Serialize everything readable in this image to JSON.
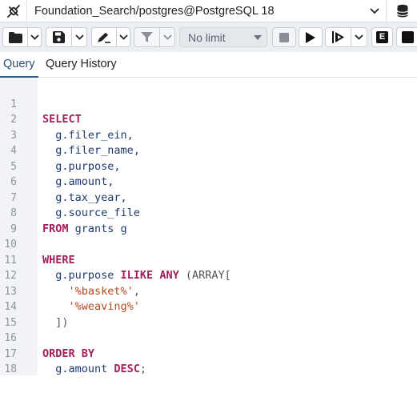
{
  "connection": {
    "label": "Foundation_Search/postgres@PostgreSQL 18"
  },
  "toolbar": {
    "limit_label": "No limit",
    "explain_label": "E"
  },
  "tabs": [
    {
      "label": "Query",
      "active": true
    },
    {
      "label": "Query History",
      "active": false
    }
  ],
  "editor": {
    "lines": [
      {
        "n": "1"
      },
      {
        "n": "2"
      },
      {
        "n": "3"
      },
      {
        "n": "4"
      },
      {
        "n": "5"
      },
      {
        "n": "6"
      },
      {
        "n": "7"
      },
      {
        "n": "8"
      },
      {
        "n": "9"
      },
      {
        "n": "10"
      },
      {
        "n": "11"
      },
      {
        "n": "12"
      },
      {
        "n": "13"
      },
      {
        "n": "14"
      },
      {
        "n": "15"
      },
      {
        "n": "16"
      },
      {
        "n": "17"
      },
      {
        "n": "18"
      }
    ],
    "code": {
      "select": "SELECT",
      "filer_ein": "  g.filer_ein,",
      "filer_name": "  g.filer_name,",
      "purpose": "  g.purpose,",
      "amount": "  g.amount,",
      "tax_year": "  g.tax_year,",
      "source_file": "  g.source_file",
      "from_kw": "FROM",
      "from_rest": " grants g",
      "where": "WHERE",
      "where_col": "  g.purpose ",
      "ilike_any": "ILIKE ANY",
      "array_open": " (ARRAY[",
      "basket": "'%basket%'",
      "basket_comma": ",",
      "weaving": "'%weaving%'",
      "array_close": "  ])",
      "order_by": "ORDER BY",
      "order_col": "  g.amount ",
      "desc": "DESC",
      "semi": ";"
    }
  },
  "colors": {
    "keyword": "#a0205c",
    "string": "#b44a1f",
    "identifier": "#1f3a6e",
    "accent": "#2c5e8e"
  }
}
